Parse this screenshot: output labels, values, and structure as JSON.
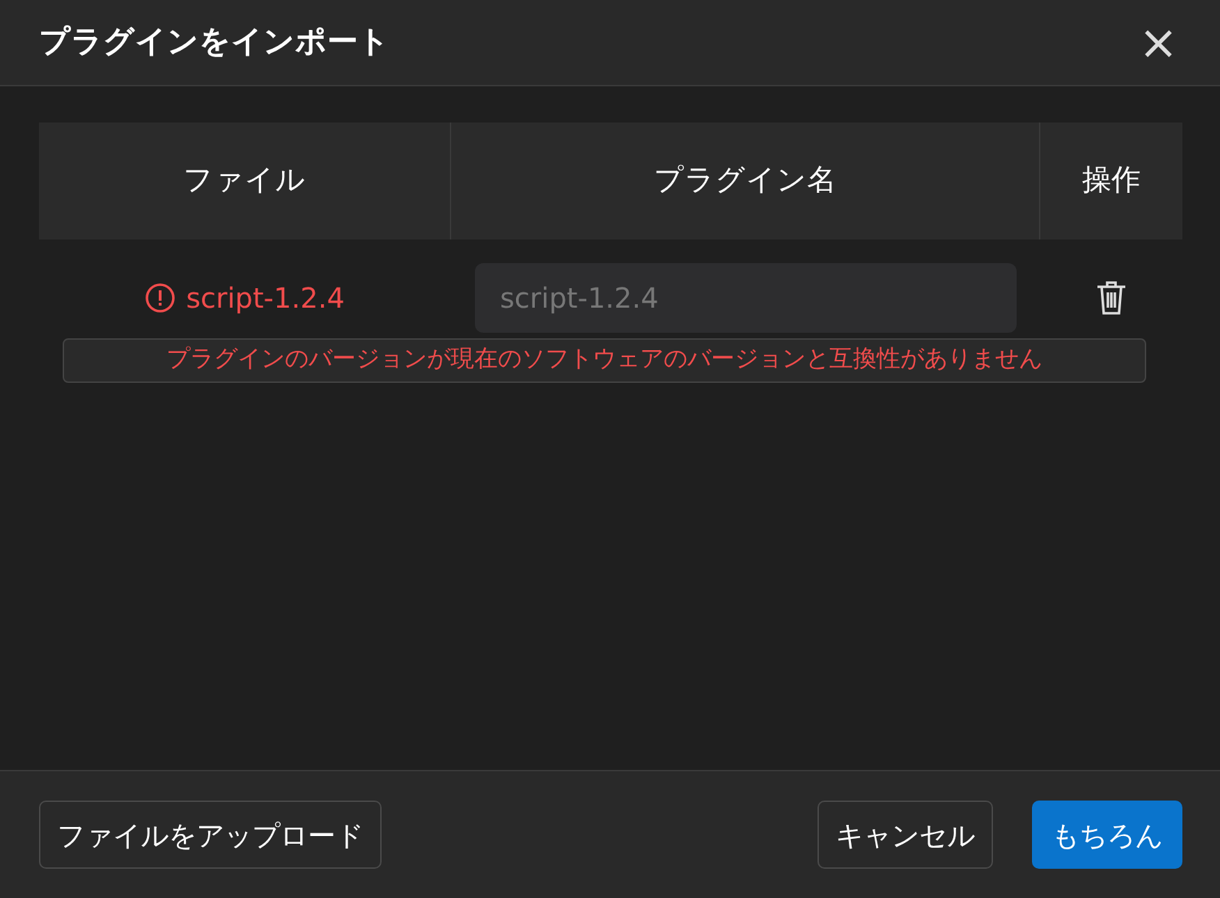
{
  "dialog": {
    "title": "プラグインをインポート",
    "close": "×"
  },
  "table": {
    "columns": [
      "ファイル",
      "プラグイン名",
      "操作"
    ],
    "rows": [
      {
        "file": "script-1.2.4",
        "invalid": true,
        "plugin_name": "script-1.2.4",
        "error": "プラグインのバージョンが現在のソフトウェアのバージョンと互換性がありません"
      }
    ]
  },
  "footer": {
    "upload": "ファイルをアップロード",
    "cancel": "キャンセル",
    "ok": "もちろん"
  }
}
